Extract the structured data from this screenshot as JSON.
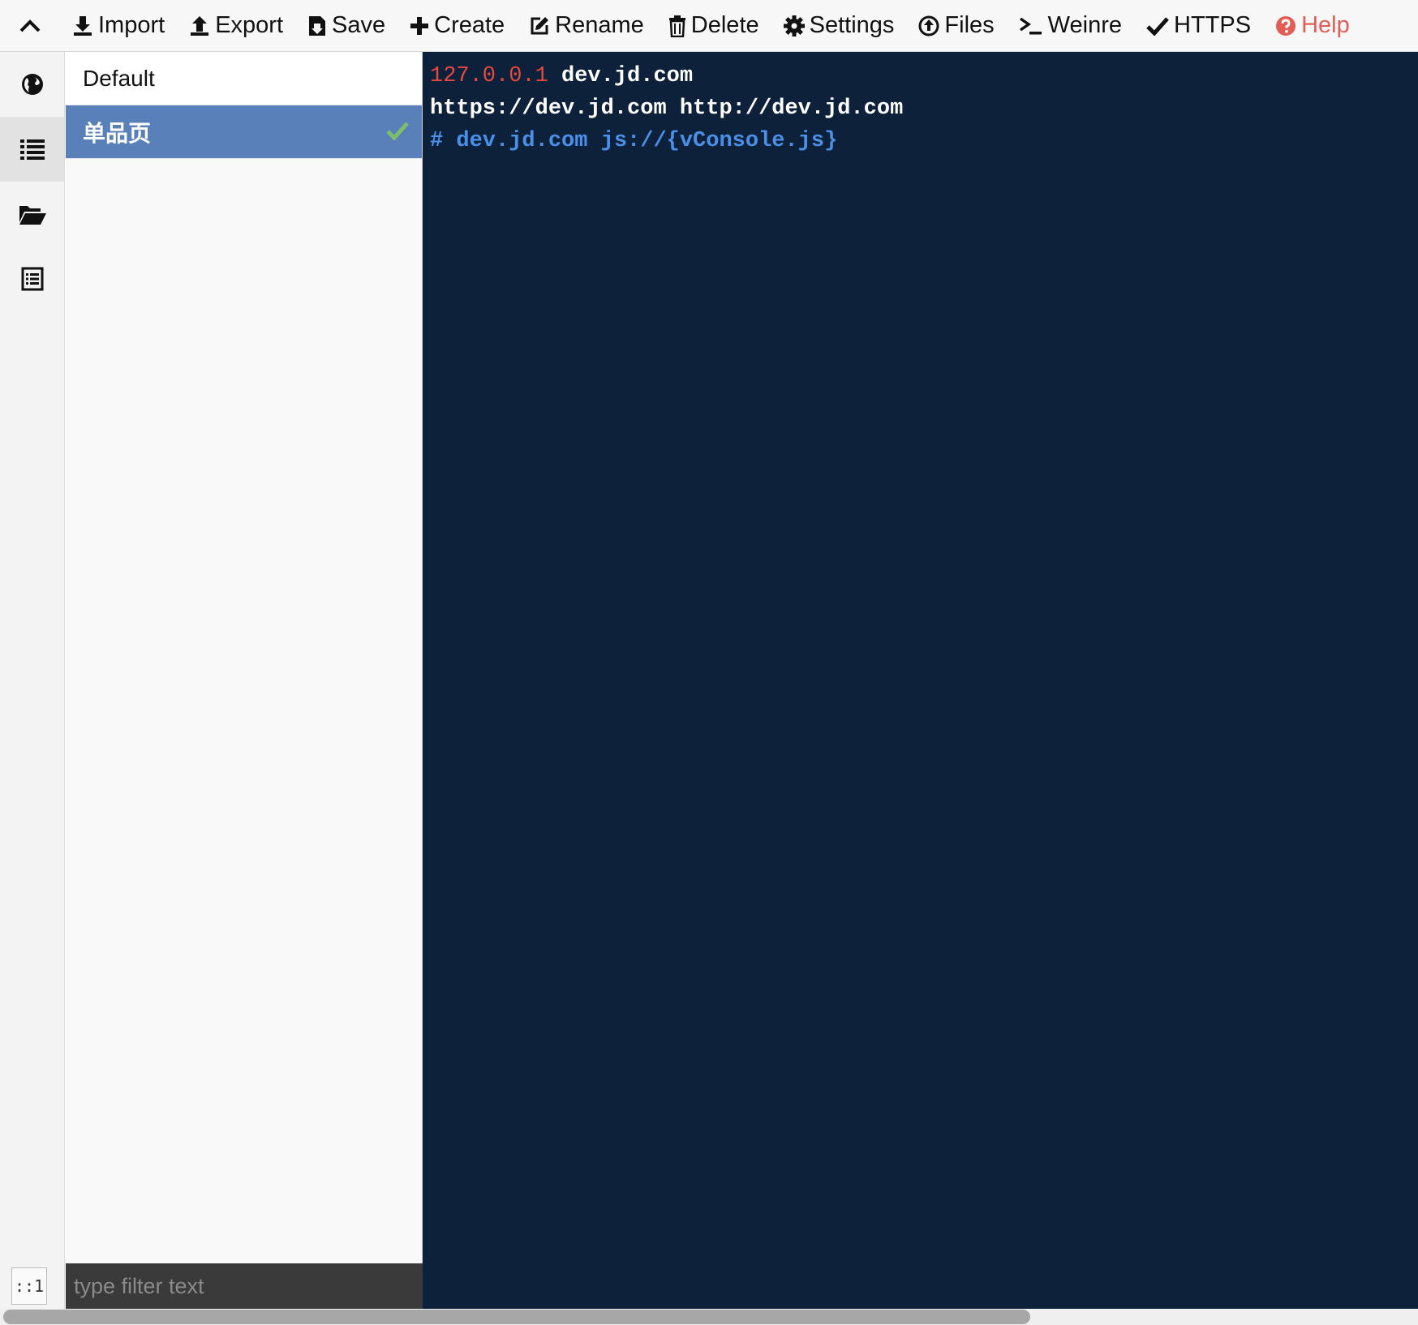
{
  "toolbar": {
    "items": [
      {
        "label": "Import",
        "icon": "import-icon"
      },
      {
        "label": "Export",
        "icon": "export-icon"
      },
      {
        "label": "Save",
        "icon": "save-icon"
      },
      {
        "label": "Create",
        "icon": "plus-icon"
      },
      {
        "label": "Rename",
        "icon": "edit-icon"
      },
      {
        "label": "Delete",
        "icon": "trash-icon"
      },
      {
        "label": "Settings",
        "icon": "gear-icon"
      },
      {
        "label": "Files",
        "icon": "upload-circle-icon"
      },
      {
        "label": "Weinre",
        "icon": "terminal-icon"
      },
      {
        "label": "HTTPS",
        "icon": "check-icon"
      },
      {
        "label": "Help",
        "icon": "question-circle-icon"
      }
    ],
    "help_color": "#e35c56"
  },
  "nav": {
    "items": [
      {
        "name": "network",
        "icon": "globe-icon"
      },
      {
        "name": "rules",
        "icon": "list-icon",
        "active": true
      },
      {
        "name": "values",
        "icon": "folder-open-icon"
      },
      {
        "name": "plugins",
        "icon": "list-alt-icon"
      }
    ],
    "line_indicator": "::1"
  },
  "rule_list": {
    "items": [
      {
        "label": "Default",
        "active": false
      },
      {
        "label": "单品页",
        "active": true
      }
    ],
    "active_color": "#5a80b9"
  },
  "filter": {
    "placeholder": "type filter text",
    "value": ""
  },
  "editor": {
    "background": "#0e213a",
    "lines": [
      {
        "ip": "127.0.0.1",
        "text": " dev.jd.com"
      },
      {
        "text": "https://dev.jd.com http://dev.jd.com"
      },
      {
        "comment": "# dev.jd.com js://{vConsole.js}"
      }
    ]
  }
}
